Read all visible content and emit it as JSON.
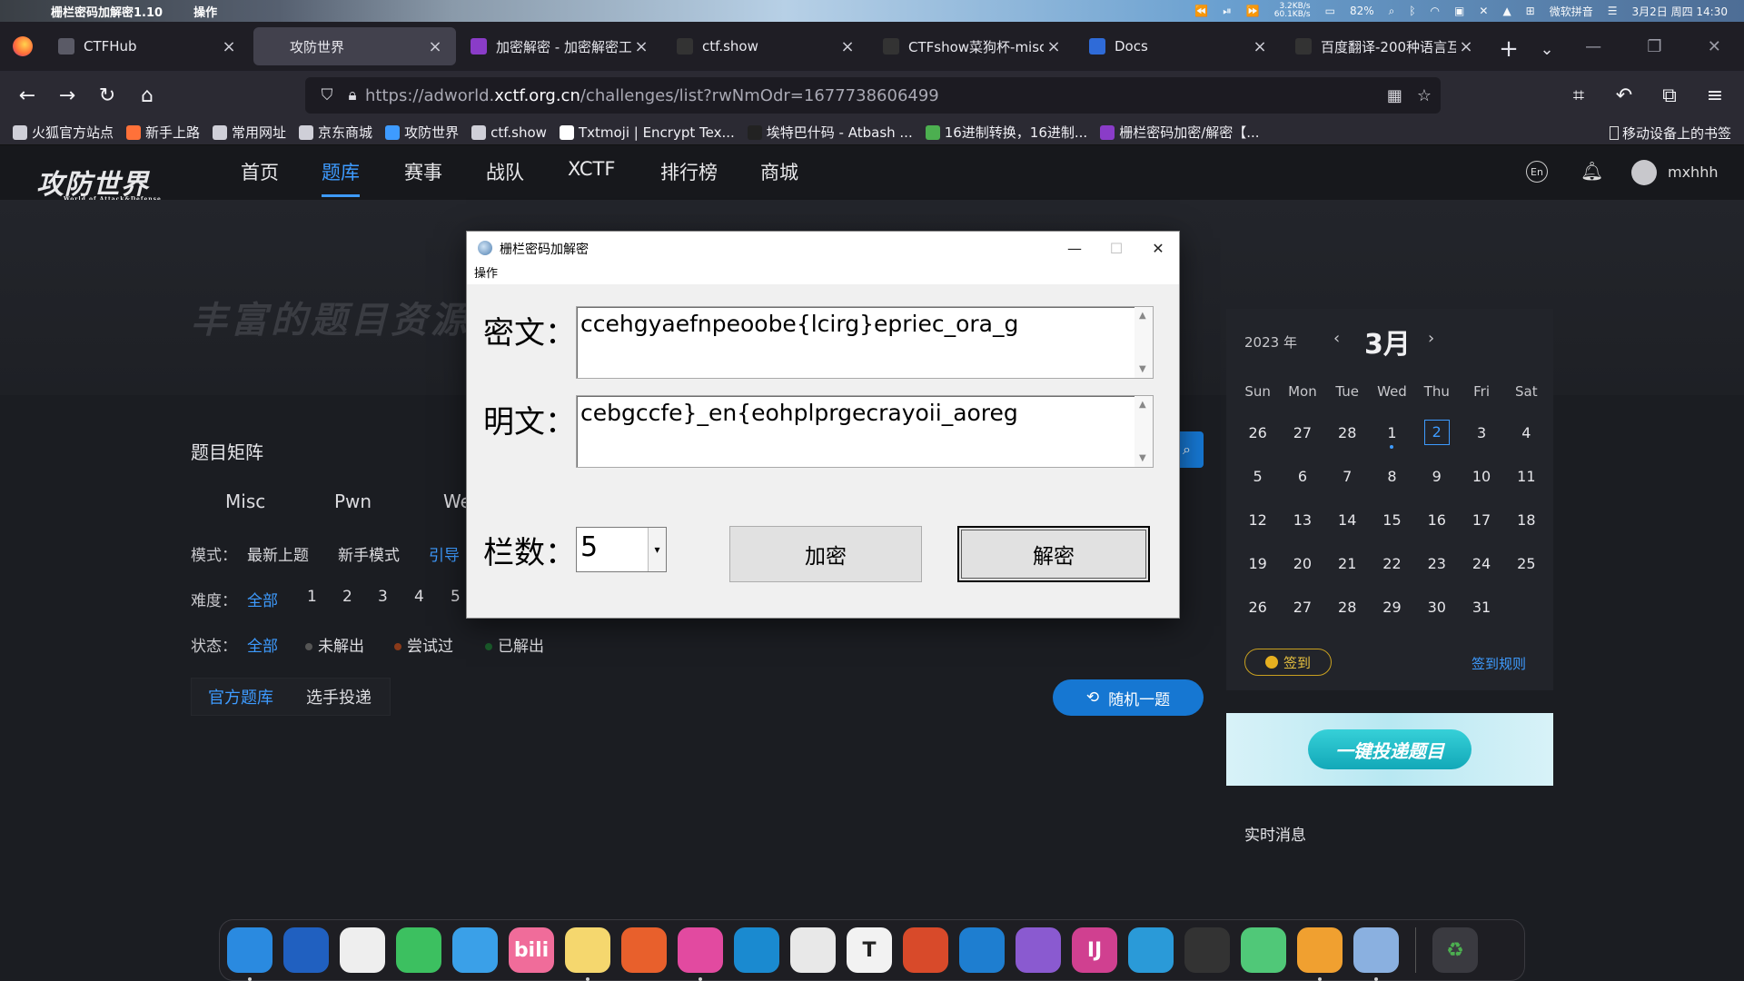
{
  "menubar": {
    "app_name": "栅栏密码加解密1.10",
    "app_menu": "操作",
    "net_up": "3.2KB/s",
    "net_down": "60.1KB/s",
    "battery": "82%",
    "ime": "微软拼音",
    "datetime": "3月2日 周四 14:30"
  },
  "tabs": [
    {
      "title": "CTFHub",
      "icon": "hexagon-icon",
      "color": "#5a5a66"
    },
    {
      "title": "攻防世界",
      "icon": "shield-icon",
      "color": "#42414d"
    },
    {
      "title": "加密解密 - 加密解密工",
      "icon": "purple-app-icon",
      "color": "#8a3cc8"
    },
    {
      "title": "ctf.show",
      "icon": "ctfshow-icon",
      "color": "#333"
    },
    {
      "title": "CTFshow菜狗杯-misc",
      "icon": "wave-icon",
      "color": "#333"
    },
    {
      "title": "Docs",
      "icon": "docs-icon",
      "color": "#2f6bd8"
    },
    {
      "title": "百度翻译-200种语言互",
      "icon": "baidu-icon",
      "color": "#333"
    }
  ],
  "active_tab_index": 1,
  "url": {
    "prefix": "https://adworld.",
    "domain": "xctf.org.cn",
    "suffix": "/challenges/list?rwNmOdr=1677738606499"
  },
  "bookmarks": [
    {
      "label": "火狐官方站点",
      "icon": "folder-icon",
      "color": "#cfcfd8"
    },
    {
      "label": "新手上路",
      "icon": "firefox-icon",
      "color": "#ff7139"
    },
    {
      "label": "常用网址",
      "icon": "folder-icon",
      "color": "#cfcfd8"
    },
    {
      "label": "京东商城",
      "icon": "globe-icon",
      "color": "#cfcfd8"
    },
    {
      "label": "攻防世界",
      "icon": "shield-icon",
      "color": "#3e9bff"
    },
    {
      "label": "ctf.show",
      "icon": "ctfshow-icon",
      "color": "#cfcfd8"
    },
    {
      "label": "Txtmoji | Encrypt Tex...",
      "icon": "triangle-icon",
      "color": "#fff"
    },
    {
      "label": "埃特巴什码 - Atbash ...",
      "icon": "circle-icon",
      "color": "#222"
    },
    {
      "label": "16进制转换，16进制...",
      "icon": "gear-icon",
      "color": "#4caf50"
    },
    {
      "label": "栅栏密码加密/解密【...",
      "icon": "purple-app-icon",
      "color": "#8a3cc8"
    }
  ],
  "bookmarks_mobile": "移动设备上的书签",
  "site": {
    "logo": "攻防世界",
    "logo_sub": "World of Attack&Defense",
    "nav": [
      "首页",
      "题库",
      "赛事",
      "战队",
      "XCTF",
      "排行榜",
      "商城"
    ],
    "nav_active": 1,
    "lang": "En",
    "username": "mxhhh",
    "hero_text": "丰富的题目资源",
    "panel_title": "题目矩阵",
    "categories": [
      "Misc",
      "Pwn",
      "We"
    ],
    "mode_label": "模式：",
    "modes": [
      "最新上题",
      "新手模式",
      "引导"
    ],
    "difficulty_label": "难度：",
    "difficulties": [
      "全部",
      "1",
      "2",
      "3",
      "4",
      "5"
    ],
    "status_label": "状态：",
    "statuses": [
      "全部",
      "未解出",
      "尝试过",
      "已解出"
    ],
    "bank_tabs": [
      "官方题库",
      "选手投递"
    ],
    "random_btn": "随机一题",
    "calendar": {
      "year": "2023 年",
      "month": "3月",
      "weekdays": [
        "Sun",
        "Mon",
        "Tue",
        "Wed",
        "Thu",
        "Fri",
        "Sat"
      ],
      "weeks": [
        [
          "26",
          "27",
          "28",
          "1",
          "2",
          "3",
          "4"
        ],
        [
          "5",
          "6",
          "7",
          "8",
          "9",
          "10",
          "11"
        ],
        [
          "12",
          "13",
          "14",
          "15",
          "16",
          "17",
          "18"
        ],
        [
          "19",
          "20",
          "21",
          "22",
          "23",
          "24",
          "25"
        ],
        [
          "26",
          "27",
          "28",
          "29",
          "30",
          "31",
          ""
        ]
      ],
      "today": "2",
      "signin": "签到",
      "signin_rules": "签到规则"
    },
    "banner_text": "一键投递题目",
    "news_title": "实时消息"
  },
  "dialog": {
    "title": "栅栏密码加解密",
    "menu": "操作",
    "cipher_label": "密文：",
    "cipher_value": "ccehgyaefnpeoobe{lcirg}epriec_ora_g",
    "plain_label": "明文：",
    "plain_value": "cebgccfe}_en{eohplprgecrayoii_aoreg",
    "rails_label": "栏数：",
    "rails_value": "5",
    "encrypt_btn": "加密",
    "decrypt_btn": "解密"
  },
  "dock": [
    {
      "name": "finder-icon",
      "color": "#2a8ae0",
      "label": "",
      "run": true
    },
    {
      "name": "launchpad-icon",
      "color": "#2060c0",
      "label": "",
      "run": false
    },
    {
      "name": "qq-icon",
      "color": "#eeeeee",
      "label": "",
      "run": false
    },
    {
      "name": "wechat-icon",
      "color": "#3cc060",
      "label": "",
      "run": false
    },
    {
      "name": "messenger-icon",
      "color": "#3aa0e8",
      "label": "",
      "run": false
    },
    {
      "name": "bilibili-icon",
      "color": "#f06c9a",
      "label": "bili",
      "run": false
    },
    {
      "name": "notes-icon",
      "color": "#f5d76e",
      "label": "",
      "run": true
    },
    {
      "name": "firefox-icon",
      "color": "#e8602c",
      "label": "",
      "run": false
    },
    {
      "name": "firefox-dev-icon",
      "color": "#e24aa0",
      "label": "",
      "run": true
    },
    {
      "name": "edge-icon",
      "color": "#1a8ad0",
      "label": "",
      "run": false
    },
    {
      "name": "chrome-icon",
      "color": "#e8e8e8",
      "label": "",
      "run": false
    },
    {
      "name": "typora-icon",
      "color": "#f2f2f2",
      "label": "T",
      "run": false
    },
    {
      "name": "office-icon",
      "color": "#d84a2a",
      "label": "",
      "run": false
    },
    {
      "name": "vscode-icon",
      "color": "#1e7ed0",
      "label": "",
      "run": false
    },
    {
      "name": "visual-studio-icon",
      "color": "#8a5ad0",
      "label": "",
      "run": false
    },
    {
      "name": "intellij-icon",
      "color": "#d04090",
      "label": "IJ",
      "run": false
    },
    {
      "name": "vmware-icon",
      "color": "#2a9ad8",
      "label": "",
      "run": false
    },
    {
      "name": "obs-icon",
      "color": "#333",
      "label": "",
      "run": false
    },
    {
      "name": "music-icon",
      "color": "#50c878",
      "label": "",
      "run": false
    },
    {
      "name": "search-app-icon",
      "color": "#f0a030",
      "label": "",
      "run": true
    },
    {
      "name": "rail-cipher-app-icon",
      "color": "#8ab0e0",
      "label": "",
      "run": true
    }
  ]
}
